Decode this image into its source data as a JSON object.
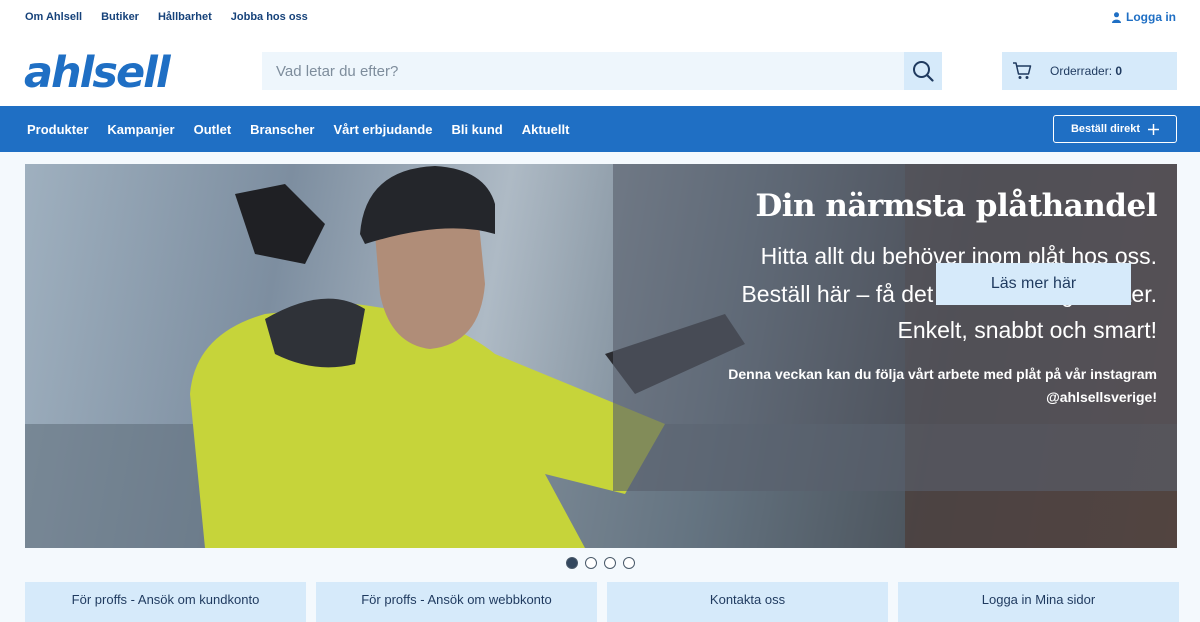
{
  "topbar": {
    "links": [
      "Om Ahlsell",
      "Butiker",
      "Hållbarhet",
      "Jobba hos oss"
    ],
    "login_label": "Logga in"
  },
  "header": {
    "logo_text": "ahlsell",
    "search_placeholder": "Vad letar du efter?",
    "cart_label": "Orderrader:",
    "cart_count": "0"
  },
  "nav": {
    "items": [
      "Produkter",
      "Kampanjer",
      "Outlet",
      "Branscher",
      "Vårt erbjudande",
      "Bli kund",
      "Aktuellt"
    ],
    "order_direct_label": "Beställ direkt"
  },
  "hero": {
    "title": "Din närmsta plåthandel",
    "line1": "Hitta allt du behöver inom plåt hos oss.",
    "line2": "Beställ här – få det levererat dagen efter.",
    "line3": "Enkelt, snabbt och smart!",
    "small1": "Denna veckan kan du följa vårt arbete med plåt på vår instagram",
    "small2": "@ahlsellsverige!",
    "cta_label": "Läs mer här"
  },
  "carousel": {
    "active_index": 0,
    "count": 4
  },
  "tiles": [
    "För proffs - Ansök om kundkonto",
    "För proffs - Ansök om webbkonto",
    "Kontakta oss",
    "Logga in Mina sidor"
  ],
  "colors": {
    "brand_blue": "#1f6fc4",
    "light_blue": "#d6eafa",
    "text_dark": "#1f3a5f"
  }
}
